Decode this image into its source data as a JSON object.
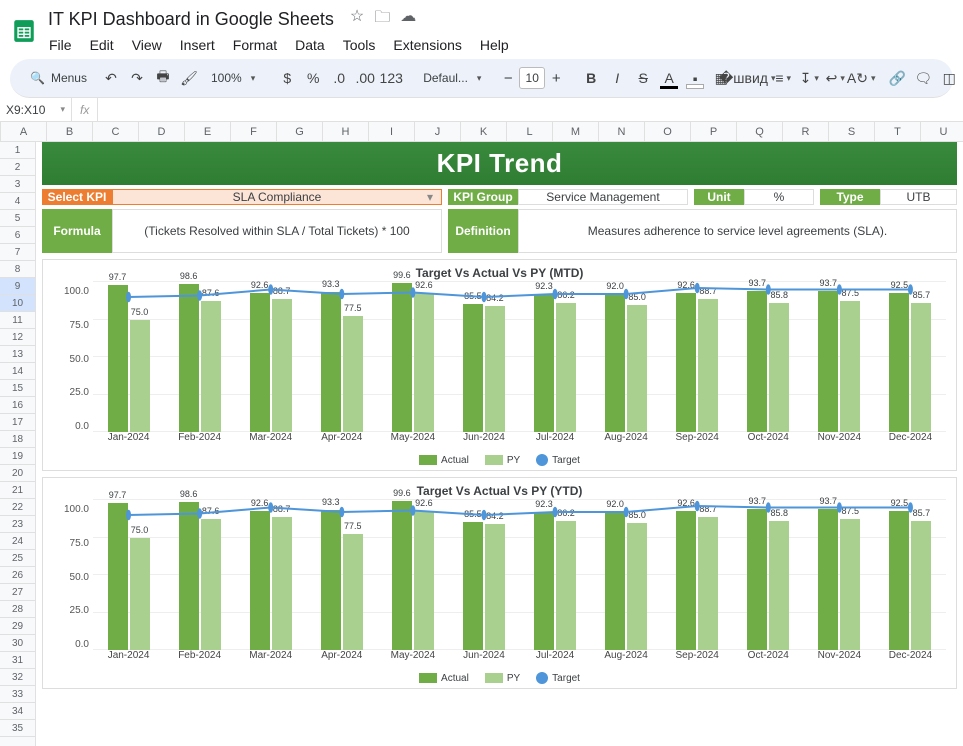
{
  "doc": {
    "title": "IT KPI Dashboard in Google Sheets"
  },
  "menu": [
    "File",
    "Edit",
    "View",
    "Insert",
    "Format",
    "Data",
    "Tools",
    "Extensions",
    "Help"
  ],
  "toolbar": {
    "search_label": "Menus",
    "zoom": "100%",
    "font": "Defaul...",
    "font_size": "10"
  },
  "namebox": {
    "ref": "X9:X10",
    "fx": "fx"
  },
  "columns": [
    "A",
    "B",
    "C",
    "D",
    "E",
    "F",
    "G",
    "H",
    "I",
    "J",
    "K",
    "L",
    "M",
    "N",
    "O",
    "P",
    "Q",
    "R",
    "S",
    "T",
    "U"
  ],
  "row_count": 35,
  "selected_rows": [
    9,
    10
  ],
  "dashboard": {
    "title": "KPI Trend",
    "select_kpi_label": "Select KPI",
    "select_kpi_value": "SLA Compliance",
    "kpi_group_label": "KPI Group",
    "kpi_group_value": "Service Management",
    "unit_label": "Unit",
    "unit_value": "%",
    "type_label": "Type",
    "type_value": "UTB",
    "formula_label": "Formula",
    "formula_value": "(Tickets Resolved within SLA / Total Tickets) * 100",
    "definition_label": "Definition",
    "definition_value": "Measures adherence to service level agreements (SLA)."
  },
  "legend": {
    "actual": "Actual",
    "py": "PY",
    "target": "Target"
  },
  "chart_data": [
    {
      "type": "bar",
      "title": "Target Vs Actual Vs PY (MTD)",
      "ylim": [
        0,
        100
      ],
      "yticks": [
        0.0,
        25.0,
        50.0,
        75.0,
        100.0
      ],
      "categories": [
        "Jan-2024",
        "Feb-2024",
        "Mar-2024",
        "Apr-2024",
        "May-2024",
        "Jun-2024",
        "Jul-2024",
        "Aug-2024",
        "Sep-2024",
        "Oct-2024",
        "Nov-2024",
        "Dec-2024"
      ],
      "series": [
        {
          "name": "Actual",
          "values": [
            97.7,
            98.6,
            92.6,
            93.3,
            99.6,
            85.5,
            92.3,
            92.0,
            92.6,
            93.7,
            93.7,
            92.5
          ]
        },
        {
          "name": "PY",
          "values": [
            75.0,
            87.6,
            88.7,
            77.5,
            92.6,
            84.2,
            86.2,
            85.0,
            88.7,
            85.8,
            87.5,
            85.7
          ]
        },
        {
          "name": "Target",
          "type": "line",
          "values": [
            90,
            91,
            95,
            92,
            93,
            90,
            92,
            92,
            96,
            95,
            95,
            95
          ]
        }
      ]
    },
    {
      "type": "bar",
      "title": "Target Vs Actual Vs PY (YTD)",
      "ylim": [
        0,
        100
      ],
      "yticks": [
        0.0,
        25.0,
        50.0,
        75.0,
        100.0
      ],
      "categories": [
        "Jan-2024",
        "Feb-2024",
        "Mar-2024",
        "Apr-2024",
        "May-2024",
        "Jun-2024",
        "Jul-2024",
        "Aug-2024",
        "Sep-2024",
        "Oct-2024",
        "Nov-2024",
        "Dec-2024"
      ],
      "series": [
        {
          "name": "Actual",
          "values": [
            97.7,
            98.6,
            92.6,
            93.3,
            99.6,
            85.5,
            92.3,
            92.0,
            92.6,
            93.7,
            93.7,
            92.5
          ]
        },
        {
          "name": "PY",
          "values": [
            75.0,
            87.6,
            88.7,
            77.5,
            92.6,
            84.2,
            86.2,
            85.0,
            88.7,
            85.8,
            87.5,
            85.7
          ]
        },
        {
          "name": "Target",
          "type": "line",
          "values": [
            90,
            91,
            95,
            92,
            93,
            90,
            92,
            92,
            96,
            95,
            95,
            95
          ]
        }
      ]
    }
  ]
}
